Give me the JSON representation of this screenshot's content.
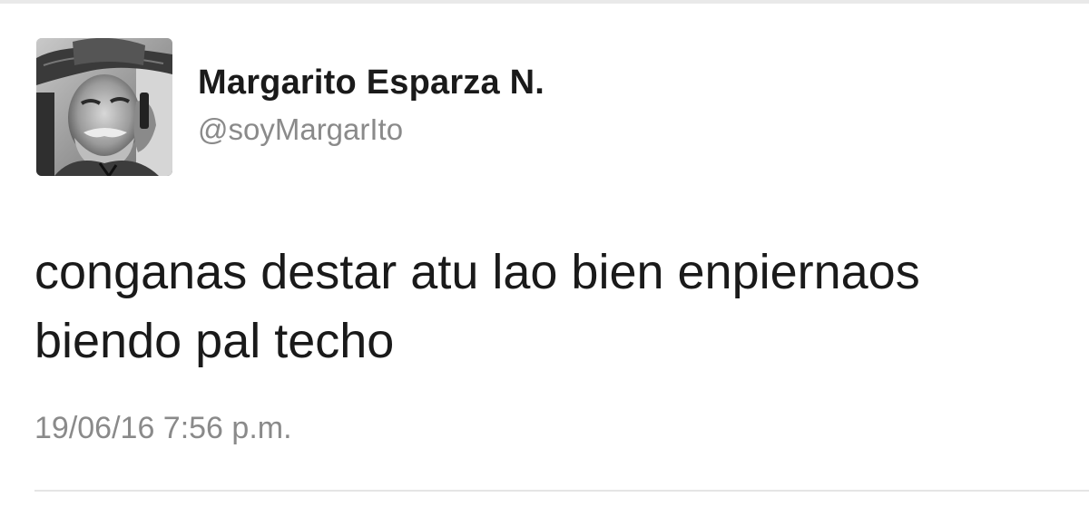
{
  "tweet": {
    "author_name": "Margarito Esparza N.",
    "author_handle": "@soyMargarIto",
    "text": "conganas destar atu lao bien enpiernaos\nbiendo pal techo",
    "timestamp": "19/06/16 7:56 p.m."
  },
  "colors": {
    "name": "#1a1a1a",
    "secondary": "#8a8a8a",
    "background": "#ffffff",
    "divider": "#e5e5e5"
  },
  "icons": {
    "avatar": "profile-photo"
  }
}
